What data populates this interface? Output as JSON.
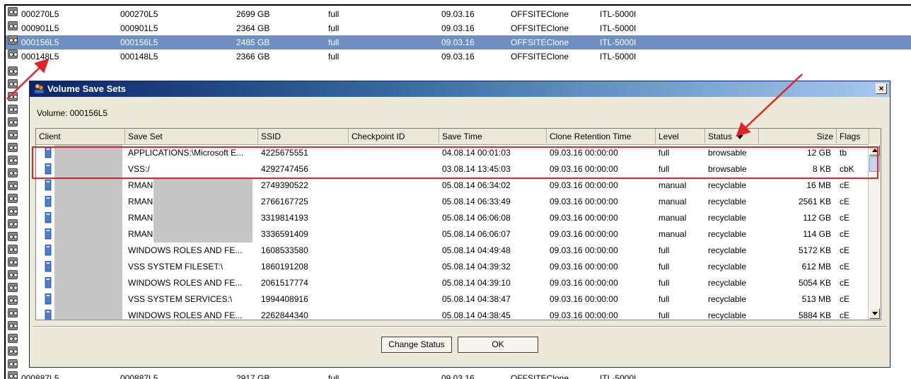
{
  "background_rows": [
    {
      "cells": [
        "000270L5",
        "000270L5",
        "2699 GB",
        "full",
        "09.03.16",
        "OFFSITEClone",
        "ITL-5000I"
      ],
      "selected": false
    },
    {
      "cells": [
        "000901L5",
        "000901L5",
        "2364 GB",
        "full",
        "09.03.16",
        "OFFSITEClone",
        "ITL-5000I"
      ],
      "selected": false
    },
    {
      "cells": [
        "000156L5",
        "000156L5",
        "2485 GB",
        "full",
        "09.03.16",
        "OFFSITEClone",
        "ITL-5000I"
      ],
      "selected": true
    },
    {
      "cells": [
        "000148L5",
        "000148L5",
        "2366 GB",
        "full",
        "09.03.16",
        "OFFSITEClone",
        "ITL-5000I"
      ],
      "selected": false
    }
  ],
  "bottom_row": {
    "cells": [
      "000887L5",
      "000887L5",
      "2917 GB",
      "full",
      "09.03.16",
      "OFFSITEClone",
      "ITL-5000I"
    ]
  },
  "dialog": {
    "title": "Volume Save Sets",
    "close_label": "×",
    "volume_label": "Volume: 000156L5",
    "columns": [
      "Client",
      "Save Set",
      "SSID",
      "Checkpoint ID",
      "Save Time",
      "Clone Retention Time",
      "Level",
      "Status",
      "Size",
      "Flags"
    ],
    "rows": [
      {
        "saveset": "APPLICATIONS:\\Microsoft E...",
        "ssid": "4225675551",
        "checkpoint": "",
        "savetime": "04.08.14 00:01:03",
        "clone": "09.03.16 00:00:00",
        "level": "full",
        "status": "browsable",
        "size": "12 GB",
        "flags": "tb"
      },
      {
        "saveset": "VSS:/",
        "ssid": "4292747456",
        "checkpoint": "",
        "savetime": "03.08.14 13:45:03",
        "clone": "09.03.16 00:00:00",
        "level": "full",
        "status": "browsable",
        "size": "8 KB",
        "flags": "cbK"
      },
      {
        "saveset": "RMAN:",
        "ssid": "2749390522",
        "checkpoint": "",
        "savetime": "05.08.14 06:34:02",
        "clone": "09.03.16 00:00:00",
        "level": "manual",
        "status": "recyclable",
        "size": "16 MB",
        "flags": "cE"
      },
      {
        "saveset": "RMAN:",
        "ssid": "2766167725",
        "checkpoint": "",
        "savetime": "05.08.14 06:33:49",
        "clone": "09.03.16 00:00:00",
        "level": "manual",
        "status": "recyclable",
        "size": "2561 KB",
        "flags": "cE"
      },
      {
        "saveset": "RMAN:",
        "ssid": "3319814193",
        "checkpoint": "",
        "savetime": "05.08.14 06:06:08",
        "clone": "09.03.16 00:00:00",
        "level": "manual",
        "status": "recyclable",
        "size": "112 GB",
        "flags": "cE"
      },
      {
        "saveset": "RMAN:",
        "ssid": "3336591409",
        "checkpoint": "",
        "savetime": "05.08.14 06:06:07",
        "clone": "09.03.16 00:00:00",
        "level": "manual",
        "status": "recyclable",
        "size": "114 GB",
        "flags": "cE"
      },
      {
        "saveset": "WINDOWS ROLES AND FE...",
        "ssid": "1608533580",
        "checkpoint": "",
        "savetime": "05.08.14 04:49:48",
        "clone": "09.03.16 00:00:00",
        "level": "full",
        "status": "recyclable",
        "size": "5172 KB",
        "flags": "cE"
      },
      {
        "saveset": "VSS SYSTEM FILESET:\\",
        "ssid": "1860191208",
        "checkpoint": "",
        "savetime": "05.08.14 04:39:32",
        "clone": "09.03.16 00:00:00",
        "level": "full",
        "status": "recyclable",
        "size": "612 MB",
        "flags": "cE"
      },
      {
        "saveset": "WINDOWS ROLES AND FE...",
        "ssid": "2061517774",
        "checkpoint": "",
        "savetime": "05.08.14 04:39:10",
        "clone": "09.03.16 00:00:00",
        "level": "full",
        "status": "recyclable",
        "size": "5054 KB",
        "flags": "cE"
      },
      {
        "saveset": "VSS SYSTEM SERVICES:\\",
        "ssid": "1994408916",
        "checkpoint": "",
        "savetime": "05.08.14 04:38:47",
        "clone": "09.03.16 00:00:00",
        "level": "full",
        "status": "recyclable",
        "size": "513 MB",
        "flags": "cE"
      },
      {
        "saveset": "WINDOWS ROLES AND FE...",
        "ssid": "2262844340",
        "checkpoint": "",
        "savetime": "05.08.14 04:38:45",
        "clone": "09.03.16 00:00:00",
        "level": "full",
        "status": "recyclable",
        "size": "5884 KB",
        "flags": "cE"
      }
    ],
    "buttons": {
      "change_status": "Change Status",
      "ok": "OK"
    }
  },
  "icons": {
    "tape": "tape-icon",
    "client": "client-icon",
    "title": "volume-save-sets-icon"
  },
  "colors": {
    "selection": "#6f8fc0",
    "annotation": "#e0242a",
    "title_bar": "#0a246a"
  }
}
